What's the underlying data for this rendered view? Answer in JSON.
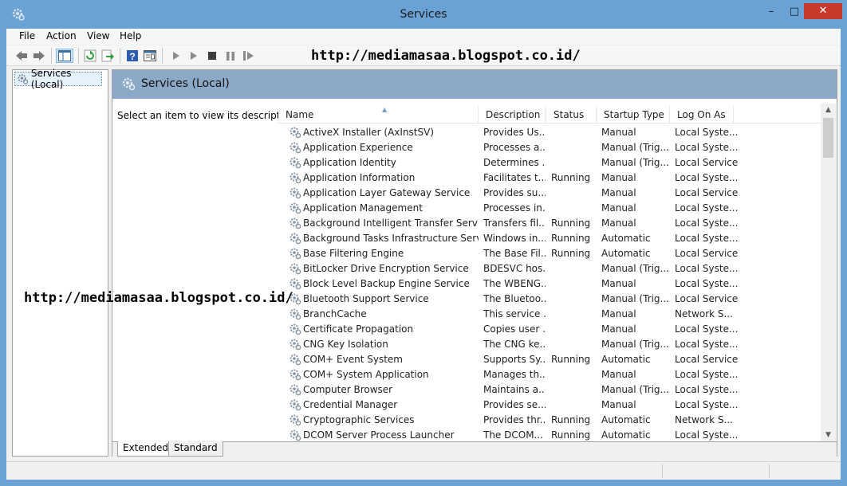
{
  "window": {
    "title": "Services",
    "minimize_glyph": "–",
    "maximize_glyph": "□",
    "close_glyph": "✕"
  },
  "menu": [
    "File",
    "Action",
    "View",
    "Help"
  ],
  "toolbar": {
    "icons": [
      "back-icon",
      "forward-icon",
      "show-hide-console-tree-icon",
      "refresh-icon",
      "export-list-icon",
      "help-icon",
      "properties-icon",
      "start-service-icon",
      "start-service-alt-icon",
      "stop-service-icon",
      "pause-service-icon",
      "restart-service-icon"
    ]
  },
  "watermark": "http://mediamasaa.blogspot.co.id/",
  "tree": {
    "root_label": "Services (Local)"
  },
  "pane": {
    "header_title": "Services (Local)",
    "description_hint": "Select an item to view its description."
  },
  "columns": [
    "Name",
    "Description",
    "Status",
    "Startup Type",
    "Log On As"
  ],
  "services": [
    {
      "name": "ActiveX Installer (AxInstSV)",
      "description": "Provides Us...",
      "status": "",
      "startup": "Manual",
      "logon": "Local Syste..."
    },
    {
      "name": "Application Experience",
      "description": "Processes a...",
      "status": "",
      "startup": "Manual (Trig...",
      "logon": "Local Syste..."
    },
    {
      "name": "Application Identity",
      "description": "Determines ...",
      "status": "",
      "startup": "Manual (Trig...",
      "logon": "Local Service"
    },
    {
      "name": "Application Information",
      "description": "Facilitates t...",
      "status": "Running",
      "startup": "Manual",
      "logon": "Local Syste..."
    },
    {
      "name": "Application Layer Gateway Service",
      "description": "Provides su...",
      "status": "",
      "startup": "Manual",
      "logon": "Local Service"
    },
    {
      "name": "Application Management",
      "description": "Processes in...",
      "status": "",
      "startup": "Manual",
      "logon": "Local Syste..."
    },
    {
      "name": "Background Intelligent Transfer Service",
      "description": "Transfers fil...",
      "status": "Running",
      "startup": "Manual",
      "logon": "Local Syste..."
    },
    {
      "name": "Background Tasks Infrastructure Service",
      "description": "Windows in...",
      "status": "Running",
      "startup": "Automatic",
      "logon": "Local Syste..."
    },
    {
      "name": "Base Filtering Engine",
      "description": "The Base Fil...",
      "status": "Running",
      "startup": "Automatic",
      "logon": "Local Service"
    },
    {
      "name": "BitLocker Drive Encryption Service",
      "description": "BDESVC hos...",
      "status": "",
      "startup": "Manual (Trig...",
      "logon": "Local Syste..."
    },
    {
      "name": "Block Level Backup Engine Service",
      "description": "The WBENG...",
      "status": "",
      "startup": "Manual",
      "logon": "Local Syste..."
    },
    {
      "name": "Bluetooth Support Service",
      "description": "The Bluetoo...",
      "status": "",
      "startup": "Manual (Trig...",
      "logon": "Local Service"
    },
    {
      "name": "BranchCache",
      "description": "This service ...",
      "status": "",
      "startup": "Manual",
      "logon": "Network S..."
    },
    {
      "name": "Certificate Propagation",
      "description": "Copies user ...",
      "status": "",
      "startup": "Manual",
      "logon": "Local Syste..."
    },
    {
      "name": "CNG Key Isolation",
      "description": "The CNG ke...",
      "status": "",
      "startup": "Manual (Trig...",
      "logon": "Local Syste..."
    },
    {
      "name": "COM+ Event System",
      "description": "Supports Sy...",
      "status": "Running",
      "startup": "Automatic",
      "logon": "Local Service"
    },
    {
      "name": "COM+ System Application",
      "description": "Manages th...",
      "status": "",
      "startup": "Manual",
      "logon": "Local Syste..."
    },
    {
      "name": "Computer Browser",
      "description": "Maintains a...",
      "status": "",
      "startup": "Manual (Trig...",
      "logon": "Local Syste..."
    },
    {
      "name": "Credential Manager",
      "description": "Provides se...",
      "status": "",
      "startup": "Manual",
      "logon": "Local Syste..."
    },
    {
      "name": "Cryptographic Services",
      "description": "Provides thr...",
      "status": "Running",
      "startup": "Automatic",
      "logon": "Network S..."
    },
    {
      "name": "DCOM Server Process Launcher",
      "description": "The DCOM...",
      "status": "Running",
      "startup": "Automatic",
      "logon": "Local Syste..."
    }
  ],
  "tabs": [
    "Extended",
    "Standard"
  ]
}
